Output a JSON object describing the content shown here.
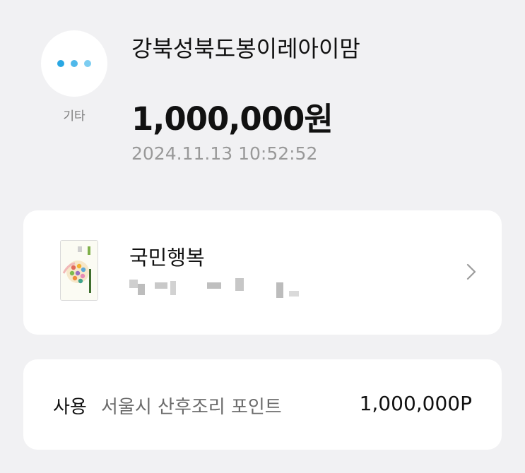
{
  "header": {
    "category_label": "기타",
    "category_icon": "more-dots-icon",
    "dot_colors": [
      "#29a7e3",
      "#4fb8ea",
      "#7ccdf1"
    ],
    "merchant": "강북성북도봉이레아이맘",
    "amount": "1,000,000원",
    "datetime": "2024.11.13 10:52:52"
  },
  "card": {
    "name": "국민행복",
    "number_masked": "(blurred)",
    "chevron_icon": "chevron-right-icon"
  },
  "usage": {
    "label": "사용",
    "description": "서울시 산후조리 포인트",
    "points_value": "1,000,000",
    "points_unit": "P"
  }
}
